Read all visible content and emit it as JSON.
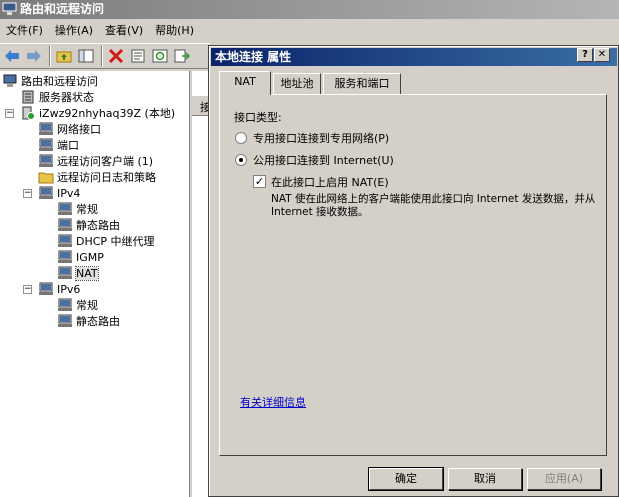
{
  "window": {
    "title": "路由和远程访问"
  },
  "menu": [
    "文件(F)",
    "操作(A)",
    "查看(V)",
    "帮助(H)"
  ],
  "tree": {
    "root": "路由和远程访问",
    "server_status": "服务器状态",
    "server": "iZwz92nhyhaq39Z (本地)",
    "items": [
      "网络接口",
      "端口",
      "远程访问客户端 (1)",
      "远程访问日志和策略"
    ],
    "ipv4": {
      "label": "IPv4",
      "children": [
        "常规",
        "静态路由",
        "DHCP 中继代理",
        "IGMP",
        "NAT"
      ]
    },
    "ipv6": {
      "label": "IPv6",
      "children": [
        "常规",
        "静态路由"
      ]
    }
  },
  "right_pane": {
    "header": "接"
  },
  "dialog": {
    "title": "本地连接 属性",
    "tabs": [
      "NAT",
      "地址池",
      "服务和端口"
    ],
    "interface_type_label": "接口类型:",
    "option_private": "专用接口连接到专用网络(P)",
    "option_public": "公用接口连接到 Internet(U)",
    "enable_nat_label": "在此接口上启用 NAT(E)",
    "description": "NAT 使在此网络上的客户端能使用此接口向 Internet 发送数据，并从 Internet 接收数据。",
    "more_info_link": "有关详细信息",
    "buttons": {
      "ok": "确定",
      "cancel": "取消",
      "apply": "应用(A)"
    }
  }
}
